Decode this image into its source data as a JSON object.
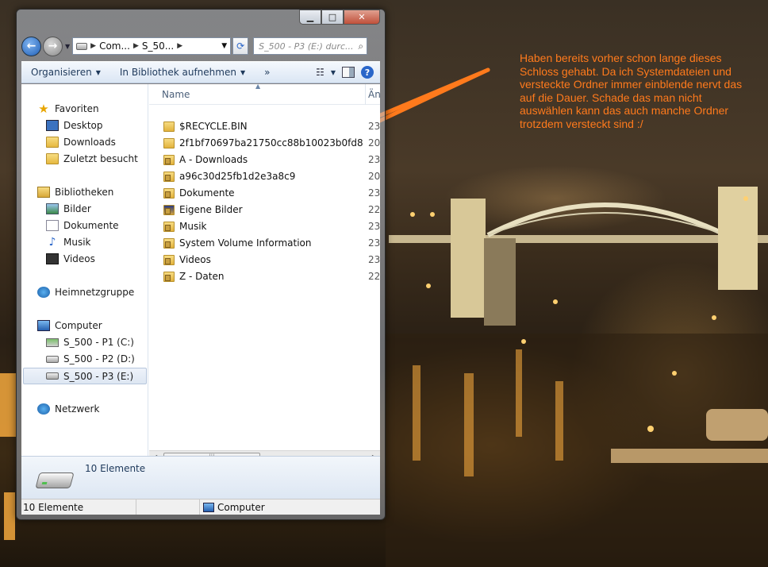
{
  "window": {
    "address": {
      "crumbs": [
        "Com...",
        "S_50..."
      ]
    },
    "search_placeholder": "S_500 - P3 (E:) durc...",
    "toolbar": {
      "organize": "Organisieren",
      "include_library": "In Bibliothek aufnehmen",
      "more": "»"
    },
    "nav": {
      "favorites": "Favoriten",
      "desktop": "Desktop",
      "downloads": "Downloads",
      "recent": "Zuletzt besucht",
      "libraries": "Bibliotheken",
      "pictures": "Bilder",
      "documents": "Dokumente",
      "music": "Musik",
      "videos": "Videos",
      "homegroup": "Heimnetzgruppe",
      "computer": "Computer",
      "drive_c": "S_500 - P1 (C:)",
      "drive_d": "S_500 - P2 (D:)",
      "drive_e": "S_500 - P3 (E:)",
      "network": "Netzwerk"
    },
    "columns": {
      "name": "Name",
      "date": "Än"
    },
    "files": [
      {
        "name": "$RECYCLE.BIN",
        "date": "23"
      },
      {
        "name": "2f1bf70697ba21750cc88b10023b0fd8",
        "date": "20"
      },
      {
        "name": "A - Downloads",
        "date": "23"
      },
      {
        "name": "a96c30d25fb1d2e3a8c9",
        "date": "20"
      },
      {
        "name": "Dokumente",
        "date": "23"
      },
      {
        "name": "Eigene Bilder",
        "date": "22"
      },
      {
        "name": "Musik",
        "date": "23"
      },
      {
        "name": "System Volume Information",
        "date": "23"
      },
      {
        "name": "Videos",
        "date": "23"
      },
      {
        "name": "Z - Daten",
        "date": "22"
      }
    ],
    "details": {
      "count": "10 Elemente"
    },
    "status": {
      "count": "10 Elemente",
      "location": "Computer"
    }
  },
  "annotation": {
    "text": "Haben bereits vorher schon lange dieses Schloss gehabt. Da ich Systemdateien und versteckte Ordner immer einblende nervt das auf die Dauer. Schade das man nicht auswählen kann das auch manche Ordner trotzdem versteckt sind :/",
    "color": "#ff7a1c"
  }
}
